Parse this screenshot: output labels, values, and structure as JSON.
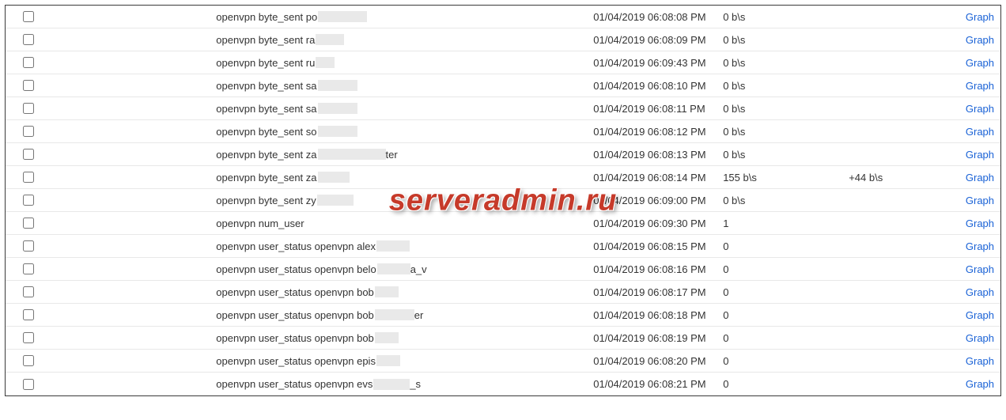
{
  "watermark": "serveradmin.ru",
  "graph_label": "Graph",
  "rows": [
    {
      "name_prefix": "openvpn byte_sent po",
      "censor_w": 62,
      "name_suffix": "",
      "date": "01/04/2019 06:08:08 PM",
      "value": "0 b\\s",
      "delta": ""
    },
    {
      "name_prefix": "openvpn byte_sent ra",
      "censor_w": 36,
      "name_suffix": "",
      "date": "01/04/2019 06:08:09 PM",
      "value": "0 b\\s",
      "delta": ""
    },
    {
      "name_prefix": "openvpn byte_sent ru",
      "censor_w": 24,
      "name_suffix": "",
      "date": "01/04/2019 06:09:43 PM",
      "value": "0 b\\s",
      "delta": ""
    },
    {
      "name_prefix": "openvpn byte_sent sa",
      "censor_w": 50,
      "name_suffix": "",
      "date": "01/04/2019 06:08:10 PM",
      "value": "0 b\\s",
      "delta": ""
    },
    {
      "name_prefix": "openvpn byte_sent sa",
      "censor_w": 50,
      "name_suffix": "",
      "date": "01/04/2019 06:08:11 PM",
      "value": "0 b\\s",
      "delta": ""
    },
    {
      "name_prefix": "openvpn byte_sent so",
      "censor_w": 50,
      "name_suffix": "",
      "date": "01/04/2019 06:08:12 PM",
      "value": "0 b\\s",
      "delta": ""
    },
    {
      "name_prefix": "openvpn byte_sent za",
      "censor_w": 86,
      "name_suffix": "ter",
      "date": "01/04/2019 06:08:13 PM",
      "value": "0 b\\s",
      "delta": ""
    },
    {
      "name_prefix": "openvpn byte_sent za",
      "censor_w": 40,
      "name_suffix": "",
      "date": "01/04/2019 06:08:14 PM",
      "value": "155 b\\s",
      "delta": "+44 b\\s"
    },
    {
      "name_prefix": "openvpn byte_sent zy",
      "censor_w": 46,
      "name_suffix": "",
      "date": "01/04/2019 06:09:00 PM",
      "value": "0 b\\s",
      "delta": ""
    },
    {
      "name_prefix": "openvpn num_user",
      "censor_w": 0,
      "name_suffix": "",
      "date": "01/04/2019 06:09:30 PM",
      "value": "1",
      "delta": ""
    },
    {
      "name_prefix": "openvpn user_status openvpn alex",
      "censor_w": 42,
      "name_suffix": "",
      "date": "01/04/2019 06:08:15 PM",
      "value": "0",
      "delta": ""
    },
    {
      "name_prefix": "openvpn user_status openvpn belo",
      "censor_w": 42,
      "name_suffix": "a_v",
      "date": "01/04/2019 06:08:16 PM",
      "value": "0",
      "delta": ""
    },
    {
      "name_prefix": "openvpn user_status openvpn bob",
      "censor_w": 30,
      "name_suffix": "",
      "date": "01/04/2019 06:08:17 PM",
      "value": "0",
      "delta": ""
    },
    {
      "name_prefix": "openvpn user_status openvpn bob",
      "censor_w": 50,
      "name_suffix": "er",
      "date": "01/04/2019 06:08:18 PM",
      "value": "0",
      "delta": ""
    },
    {
      "name_prefix": "openvpn user_status openvpn bob",
      "censor_w": 30,
      "name_suffix": "",
      "date": "01/04/2019 06:08:19 PM",
      "value": "0",
      "delta": ""
    },
    {
      "name_prefix": "openvpn user_status openvpn epis",
      "censor_w": 30,
      "name_suffix": "",
      "date": "01/04/2019 06:08:20 PM",
      "value": "0",
      "delta": ""
    },
    {
      "name_prefix": "openvpn user_status openvpn evs",
      "censor_w": 46,
      "name_suffix": "_s",
      "date": "01/04/2019 06:08:21 PM",
      "value": "0",
      "delta": ""
    }
  ]
}
